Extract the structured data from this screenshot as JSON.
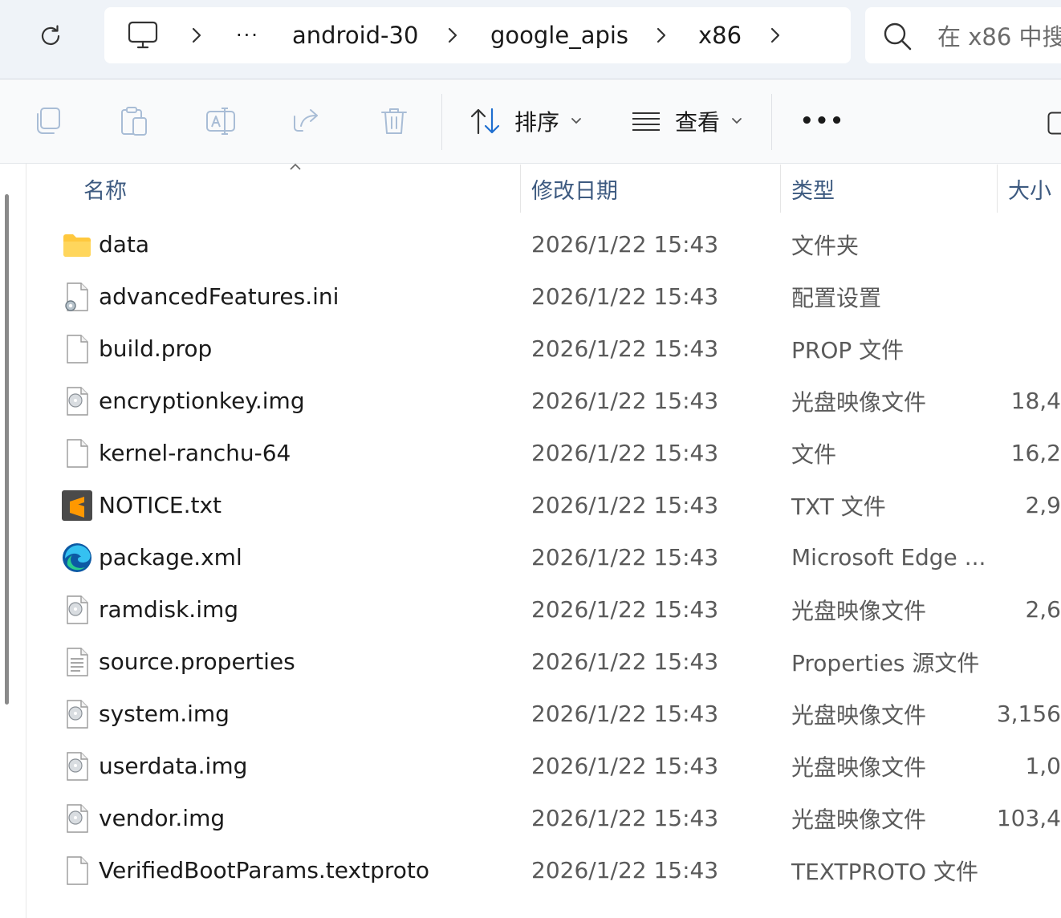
{
  "breadcrumb": {
    "items": [
      "android-30",
      "google_apis",
      "x86"
    ],
    "overflow_label": "···"
  },
  "search": {
    "placeholder": "在 x86 中搜"
  },
  "toolbar": {
    "sort_label": "排序",
    "view_label": "查看",
    "more_label": "•••"
  },
  "columns": {
    "name": "名称",
    "modified": "修改日期",
    "type": "类型",
    "size": "大小"
  },
  "files": [
    {
      "name": "data",
      "modified": "2026/1/22 15:43",
      "type": "文件夹",
      "size": "",
      "icon": "folder-icon"
    },
    {
      "name": "advancedFeatures.ini",
      "modified": "2026/1/22 15:43",
      "type": "配置设置",
      "size": "",
      "icon": "settings-file-icon"
    },
    {
      "name": "build.prop",
      "modified": "2026/1/22 15:43",
      "type": "PROP 文件",
      "size": "",
      "icon": "blank-file-icon"
    },
    {
      "name": "encryptionkey.img",
      "modified": "2026/1/22 15:43",
      "type": "光盘映像文件",
      "size": "18,4",
      "icon": "disc-image-file-icon"
    },
    {
      "name": "kernel-ranchu-64",
      "modified": "2026/1/22 15:43",
      "type": "文件",
      "size": "16,2",
      "icon": "blank-file-icon"
    },
    {
      "name": "NOTICE.txt",
      "modified": "2026/1/22 15:43",
      "type": "TXT 文件",
      "size": "2,9",
      "icon": "sublime-text-icon"
    },
    {
      "name": "package.xml",
      "modified": "2026/1/22 15:43",
      "type": "Microsoft Edge ...",
      "size": "",
      "icon": "edge-icon"
    },
    {
      "name": "ramdisk.img",
      "modified": "2026/1/22 15:43",
      "type": "光盘映像文件",
      "size": "2,6",
      "icon": "disc-image-file-icon"
    },
    {
      "name": "source.properties",
      "modified": "2026/1/22 15:43",
      "type": "Properties 源文件",
      "size": "",
      "icon": "text-file-icon"
    },
    {
      "name": "system.img",
      "modified": "2026/1/22 15:43",
      "type": "光盘映像文件",
      "size": "3,156",
      "icon": "disc-image-file-icon"
    },
    {
      "name": "userdata.img",
      "modified": "2026/1/22 15:43",
      "type": "光盘映像文件",
      "size": "1,0",
      "icon": "disc-image-file-icon"
    },
    {
      "name": "vendor.img",
      "modified": "2026/1/22 15:43",
      "type": "光盘映像文件",
      "size": "103,4",
      "icon": "disc-image-file-icon"
    },
    {
      "name": "VerifiedBootParams.textproto",
      "modified": "2026/1/22 15:43",
      "type": "TEXTPROTO 文件",
      "size": "",
      "icon": "blank-file-icon"
    }
  ],
  "colors": {
    "header_text": "#3d5a80",
    "topbar_bg": "#eff3f8",
    "folder": "#ffc83d"
  }
}
